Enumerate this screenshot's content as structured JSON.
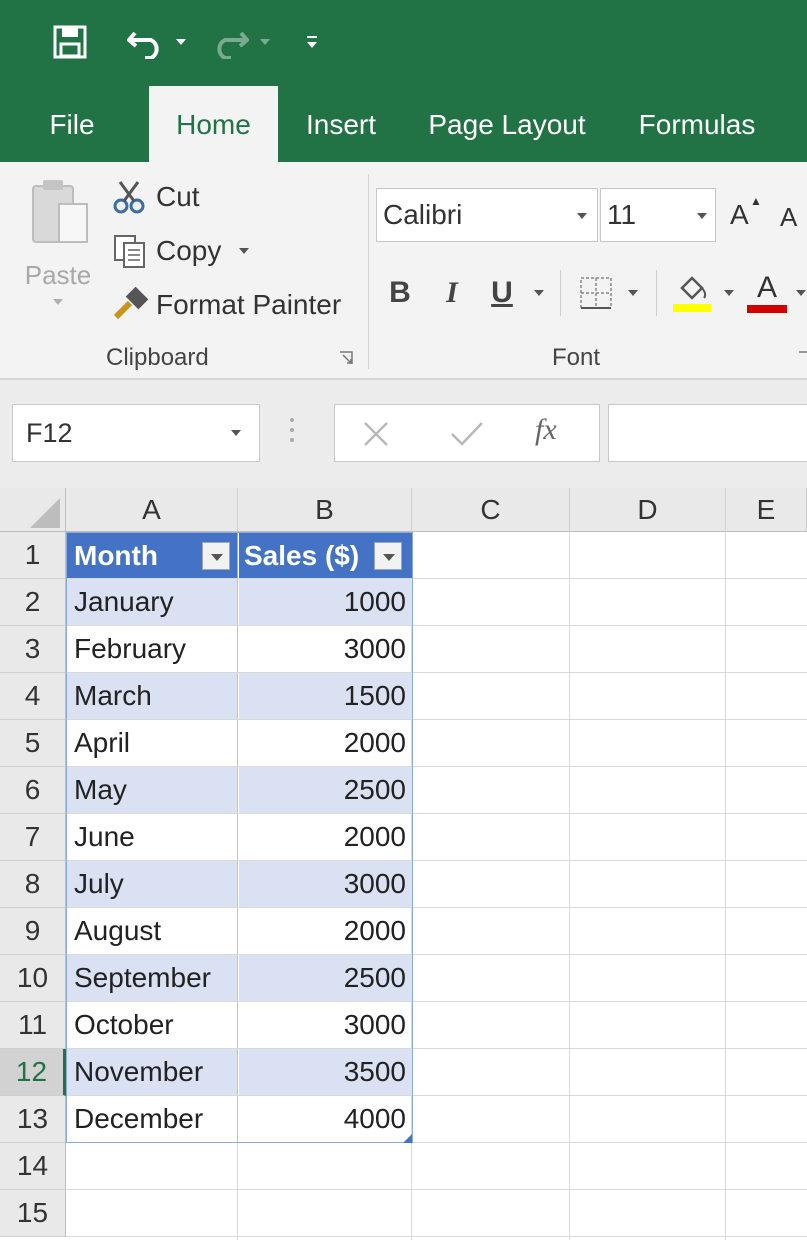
{
  "qat": {
    "save_icon": "save-icon",
    "undo_icon": "undo-icon",
    "redo_icon": "redo-icon",
    "customize_icon": "customize-qat-icon"
  },
  "tabs": [
    {
      "label": "File"
    },
    {
      "label": "Home",
      "active": true
    },
    {
      "label": "Insert"
    },
    {
      "label": "Page Layout"
    },
    {
      "label": "Formulas"
    }
  ],
  "ribbon": {
    "clipboard": {
      "paste_label": "Paste",
      "cut_label": "Cut",
      "copy_label": "Copy",
      "format_painter_label": "Format Painter",
      "group_label": "Clipboard"
    },
    "font": {
      "font_name": "Calibri",
      "font_size": "11",
      "grow_label": "A",
      "shrink_label": "A",
      "bold_label": "B",
      "italic_label": "I",
      "underline_label": "U",
      "font_color_label": "A",
      "group_label": "Font",
      "fill_color": "#ffff00",
      "font_color": "#d40000"
    }
  },
  "formula_bar": {
    "name_box": "F12",
    "cancel_icon": "cancel-icon",
    "enter_icon": "check-icon",
    "fx_label": "fx",
    "formula_value": ""
  },
  "sheet": {
    "columns": [
      "A",
      "B",
      "C",
      "D",
      "E"
    ],
    "rows": [
      "1",
      "2",
      "3",
      "4",
      "5",
      "6",
      "7",
      "8",
      "9",
      "10",
      "11",
      "12",
      "13",
      "14",
      "15"
    ],
    "selected_row": "12",
    "table_headers": [
      "Month",
      "Sales ($)"
    ],
    "table_rows": [
      {
        "month": "January",
        "sales": "1000"
      },
      {
        "month": "February",
        "sales": "3000"
      },
      {
        "month": "March",
        "sales": "1500"
      },
      {
        "month": "April",
        "sales": "2000"
      },
      {
        "month": "May",
        "sales": "2500"
      },
      {
        "month": "June",
        "sales": "2000"
      },
      {
        "month": "July",
        "sales": "3000"
      },
      {
        "month": "August",
        "sales": "2000"
      },
      {
        "month": "September",
        "sales": "2500"
      },
      {
        "month": "October",
        "sales": "3000"
      },
      {
        "month": "November",
        "sales": "3500"
      },
      {
        "month": "December",
        "sales": "4000"
      }
    ],
    "colors": {
      "header": "#4472c4",
      "band": "#d9e1f2",
      "accent": "#217346"
    }
  }
}
